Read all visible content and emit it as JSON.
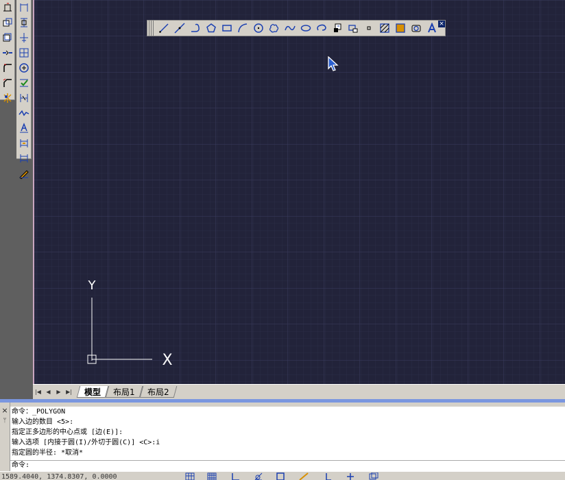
{
  "colors": {
    "canvas": "#22233a",
    "grid_minor": "#2c2e48",
    "grid_major": "#3a3c5c",
    "ucs": "#ffffff"
  },
  "left_toolbar_1": {
    "icons": [
      "stretch-icon",
      "copy-icon",
      "mirror-icon",
      "join-icon",
      "fillet-icon",
      "chamfer-icon",
      "explode-icon"
    ]
  },
  "left_toolbar_2": {
    "icons": [
      "linear-dim-icon",
      "aligned-dim-icon",
      "ordinate-dim-icon",
      "baseline-dim-icon",
      "center-mark-icon",
      "dim-check-icon",
      "dim-break-icon",
      "jogged-dim-icon",
      "text-edit-icon",
      "dim-space-icon",
      "dim-style-icon",
      "dim-edit-icon"
    ]
  },
  "draw_toolbar": {
    "icons": [
      "line-icon",
      "construction-line-icon",
      "polyline-icon",
      "polygon-icon",
      "rectangle-icon",
      "arc-icon",
      "circle-icon",
      "revision-cloud-icon",
      "spline-icon",
      "ellipse-icon",
      "ellipse-arc-icon",
      "insert-block-icon",
      "make-block-icon",
      "point-icon",
      "hatch-icon",
      "gradient-icon",
      "region-icon",
      "multiline-text-icon"
    ],
    "close_label": "×"
  },
  "ucs": {
    "y_label": "Y",
    "x_label": "X"
  },
  "tabs": {
    "model": "模型",
    "layout1": "布局1",
    "layout2": "布局2"
  },
  "tab_nav": {
    "first": "|◀",
    "prev": "◀",
    "next": "▶",
    "last": "▶|"
  },
  "command": {
    "close_label": "×",
    "pin_label": "ᛘ",
    "history": [
      "命令：_POLYGON",
      "输入边的数目 <5>:",
      "指定正多边形的中心点或 [边(E)]:",
      "输入选项 [内接于圆(I)/外切于圆(C)] <C>:i",
      "指定圆的半径: *取消*"
    ],
    "prompt": "命令:"
  },
  "status": {
    "coordinates": "1589.4040, 1374.8307, 0.0000",
    "buttons": [
      "snap-icon",
      "grid-icon",
      "ortho-icon",
      "polar-icon",
      "osnap-icon",
      "otrack-icon",
      "ducs-icon",
      "dyn-icon",
      "lwt-icon"
    ]
  }
}
